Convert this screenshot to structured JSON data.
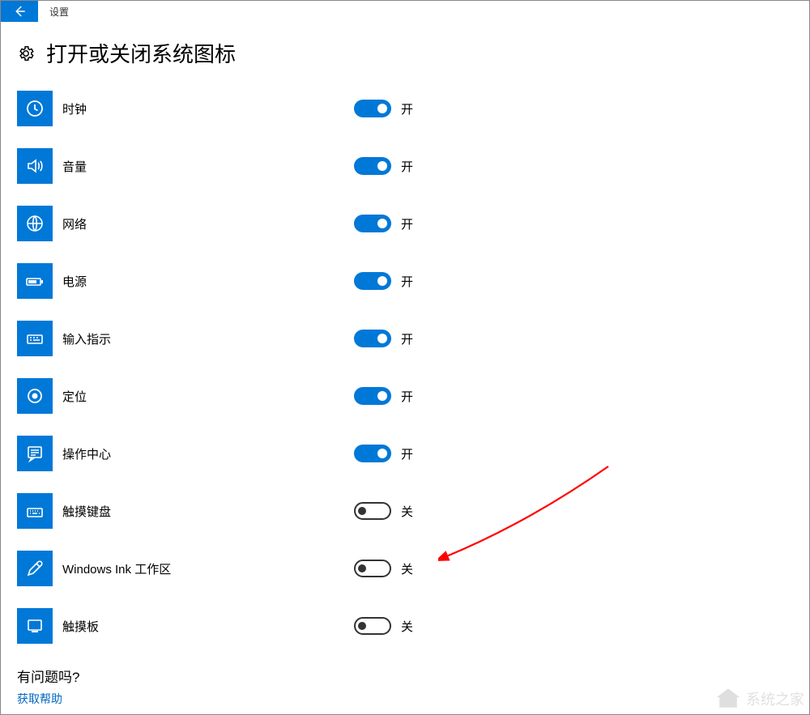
{
  "titlebar": {
    "app_title": "设置"
  },
  "page": {
    "title": "打开或关闭系统图标"
  },
  "labels": {
    "on": "开",
    "off": "关"
  },
  "items": [
    {
      "key": "clock",
      "label": "时钟",
      "state": "on",
      "icon": "clock-icon"
    },
    {
      "key": "volume",
      "label": "音量",
      "state": "on",
      "icon": "volume-icon"
    },
    {
      "key": "network",
      "label": "网络",
      "state": "on",
      "icon": "network-icon"
    },
    {
      "key": "power",
      "label": "电源",
      "state": "on",
      "icon": "power-icon"
    },
    {
      "key": "input",
      "label": "输入指示",
      "state": "on",
      "icon": "keyboard-icon"
    },
    {
      "key": "location",
      "label": "定位",
      "state": "on",
      "icon": "location-icon"
    },
    {
      "key": "action",
      "label": "操作中心",
      "state": "on",
      "icon": "action-center-icon"
    },
    {
      "key": "touchkbd",
      "label": "触摸键盘",
      "state": "off",
      "icon": "touch-keyboard-icon"
    },
    {
      "key": "ink",
      "label": "Windows Ink 工作区",
      "state": "off",
      "icon": "pen-icon"
    },
    {
      "key": "touchpad",
      "label": "触摸板",
      "state": "off",
      "icon": "touchpad-icon"
    }
  ],
  "help": {
    "question": "有问题吗?",
    "link": "获取帮助"
  },
  "watermark": {
    "text": "系统之家"
  }
}
